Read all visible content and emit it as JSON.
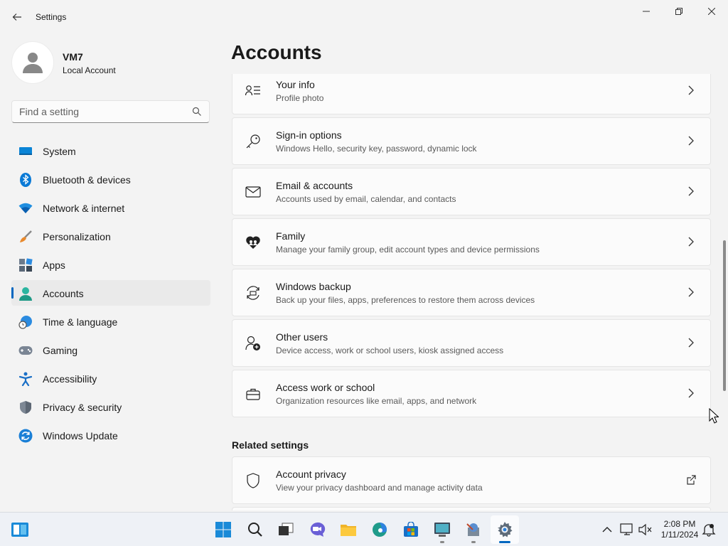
{
  "window": {
    "title": "Settings"
  },
  "profile": {
    "name": "VM7",
    "account_type": "Local Account"
  },
  "search": {
    "placeholder": "Find a setting"
  },
  "nav": {
    "items": [
      {
        "label": "System",
        "icon": "system-icon"
      },
      {
        "label": "Bluetooth & devices",
        "icon": "bluetooth-icon"
      },
      {
        "label": "Network & internet",
        "icon": "wifi-icon"
      },
      {
        "label": "Personalization",
        "icon": "brush-icon"
      },
      {
        "label": "Apps",
        "icon": "apps-icon"
      },
      {
        "label": "Accounts",
        "icon": "accounts-icon",
        "selected": true
      },
      {
        "label": "Time & language",
        "icon": "globe-clock-icon"
      },
      {
        "label": "Gaming",
        "icon": "gamepad-icon"
      },
      {
        "label": "Accessibility",
        "icon": "accessibility-icon"
      },
      {
        "label": "Privacy & security",
        "icon": "shield-icon"
      },
      {
        "label": "Windows Update",
        "icon": "update-icon"
      }
    ]
  },
  "page": {
    "title": "Accounts"
  },
  "cards": [
    {
      "title": "Your info",
      "subtitle": "Profile photo",
      "icon": "person-info-icon"
    },
    {
      "title": "Sign-in options",
      "subtitle": "Windows Hello, security key, password, dynamic lock",
      "icon": "key-icon"
    },
    {
      "title": "Email & accounts",
      "subtitle": "Accounts used by email, calendar, and contacts",
      "icon": "mail-icon"
    },
    {
      "title": "Family",
      "subtitle": "Manage your family group, edit account types and device permissions",
      "icon": "family-heart-icon"
    },
    {
      "title": "Windows backup",
      "subtitle": "Back up your files, apps, preferences to restore them across devices",
      "icon": "backup-icon"
    },
    {
      "title": "Other users",
      "subtitle": "Device access, work or school users, kiosk assigned access",
      "icon": "add-user-icon"
    },
    {
      "title": "Access work or school",
      "subtitle": "Organization resources like email, apps, and network",
      "icon": "briefcase-icon"
    }
  ],
  "related": {
    "heading": "Related settings",
    "items": [
      {
        "title": "Account privacy",
        "subtitle": "View your privacy dashboard and manage activity data",
        "icon": "shield-outline-icon"
      }
    ]
  },
  "taskbar": {
    "time": "2:08 PM",
    "date": "1/11/2024"
  },
  "colors": {
    "accent": "#0067c0",
    "background": "#f3f3f3",
    "card": "#fbfbfb"
  }
}
